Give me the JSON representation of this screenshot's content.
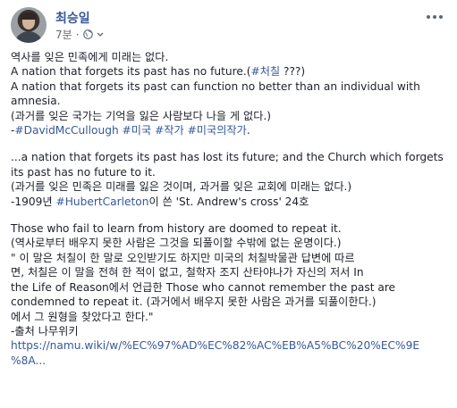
{
  "author": {
    "name": "최승일"
  },
  "meta": {
    "time": "7분",
    "separator": "·"
  },
  "post": {
    "p1": {
      "l1": "역사를 잊은 민족에게 미래는 없다.",
      "l2": "A nation that forgets its past has no future.(",
      "l2_tag": "#처칠",
      "l2_end": " ???)",
      "l3": "A nation that forgets its past can function no better than an individual with",
      "l4": "amnesia.",
      "l5": "(과거를 잊은 국가는 기억을 잃은 사람보다 나을 게 없다.)",
      "l6_prefix": "-",
      "l6_tags": [
        "#DavidMcCullough",
        "#미국",
        "#작가",
        "#미국의작가"
      ],
      "l6_end": "."
    },
    "p2": {
      "l1": "...a nation that forgets its past has lost its future; and the Church which forgets",
      "l2": "its past has no future to it.",
      "l3": "(과거를 잊은 민족은 미래를 잃은 것이며, 과거를 잊은 교회에 미래는 없다.)",
      "l4_prefix": "-1909년 ",
      "l4_tag": "#HubertCarleton",
      "l4_end": "이 쓴 'St. Andrew's cross' 24호"
    },
    "p3": {
      "l1": "Those who fail to learn from history are doomed to repeat it.",
      "l2": "(역사로부터 배우지 못한 사람은 그것을 되풀이할 수밖에 없는 운명이다.)",
      "l3": "\" 이 말은 처칠이 한 말로 오인받기도 하지만 미국의 처칠박물관 답변에 따르",
      "l4": "면, 처칠은 이 말을 전혀 한 적이 없고, 철학자 조지 산타야나가 자신의 저서 In",
      "l5": "the Life of Reason에서 언급한 Those who cannot remember the past are",
      "l6": "condemned to repeat it. (과거에서 배우지 못한 사람은 과거를 되풀이한다.)",
      "l7": "에서 그 원형을 찾았다고 한다.\"",
      "l8": "-출처 나무위키",
      "url1": "https://namu.wiki/w/%EC%97%AD%EC%82%AC%EB%A5%BC%20%EC%9E",
      "url2": "%8A..."
    }
  },
  "colors": {
    "link": "#365899",
    "text": "#1d2129",
    "meta": "#616770"
  }
}
